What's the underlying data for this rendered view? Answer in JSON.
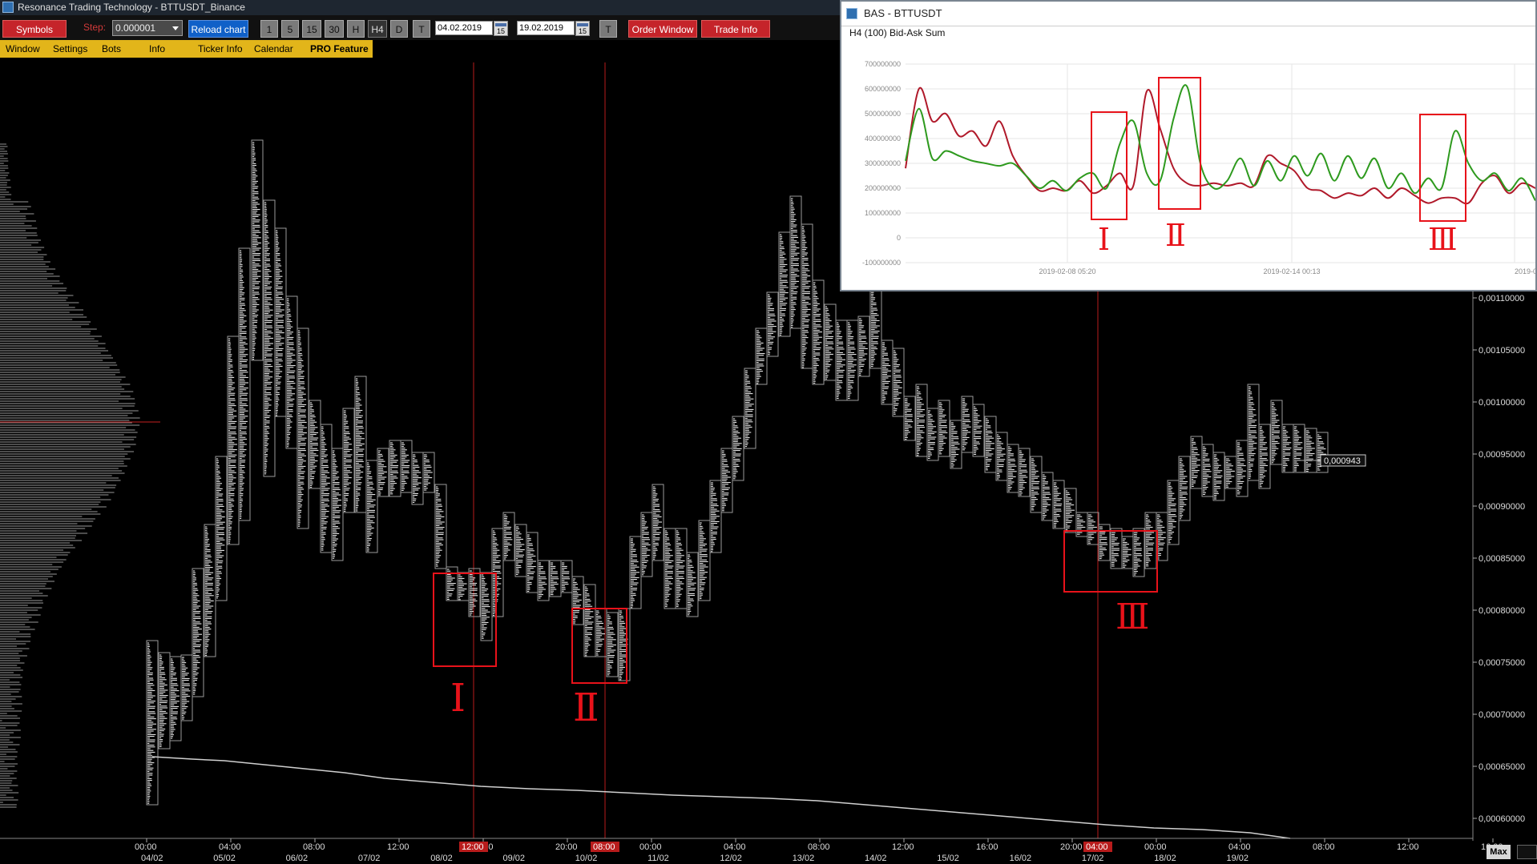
{
  "window": {
    "title": "Resonance Trading Technology - BTTUSDT_Binance"
  },
  "toolbar": {
    "symbols_label": "Symbols",
    "step_label": "Step:",
    "step_value": "0.000001",
    "reload_label": "Reload chart",
    "timeframes": [
      "1",
      "5",
      "15",
      "30",
      "H",
      "H4",
      "D"
    ],
    "t_label": "T",
    "date_from": "04.02.2019",
    "date_to": "19.02.2019",
    "calendar_day": "15",
    "order_window_label": "Order Window",
    "trade_info_label": "Trade Info"
  },
  "menu": {
    "items": [
      "Window",
      "Settings",
      "Bots",
      "Info",
      "Ticker Info",
      "Calendar",
      "PRO Feature"
    ]
  },
  "colors": {
    "accent_yellow": "#e2b51a",
    "button_red": "#c5242a",
    "button_blue": "#1060c8",
    "marker_red": "#e8121a",
    "series_red": "#b0192a",
    "series_green": "#2e9a1e"
  },
  "main_chart": {
    "price_ticks": [
      "0,00110000",
      "0,00105000",
      "0,00100000",
      "0,00095000",
      "0,00090000",
      "0,00085000",
      "0,00080000",
      "0,00075000",
      "0,00070000",
      "0,00065000",
      "0,00060000"
    ],
    "time_ticks": [
      "00:00",
      "04:00",
      "08:00",
      "12:00",
      "16:00",
      "20:00",
      "00:00",
      "04:00",
      "08:00",
      "12:00",
      "16:00",
      "20:00",
      "00:00",
      "04:00",
      "08:00",
      "12:00",
      "16:00",
      "20:00",
      "00:00",
      "04:00"
    ],
    "date_ticks": [
      "04/02",
      "05/02",
      "06/02",
      "07/02",
      "08/02",
      "09/02",
      "10/02",
      "11/02",
      "12/02",
      "13/02",
      "14/02",
      "15/02",
      "16/02",
      "17/02",
      "18/02",
      "19/02"
    ],
    "cursor_times": [
      "12:00",
      "08:00",
      "04:00"
    ],
    "current_price_label": "0,000943",
    "region_labels": [
      "Ⅰ",
      "Ⅱ",
      "Ⅲ"
    ]
  },
  "inset": {
    "window_title": "BAS - BTTUSDT",
    "subtitle": "H4 (100) Bid-Ask Sum",
    "y_ticks": [
      "700000000",
      "600000000",
      "500000000",
      "400000000",
      "300000000",
      "200000000",
      "100000000",
      "0",
      "-100000000"
    ],
    "x_ticks": [
      "2019-02-08 05:20",
      "2019-02-14 00:13",
      "2019-0"
    ],
    "region_labels": [
      "Ⅰ",
      "Ⅱ",
      "Ⅲ"
    ]
  },
  "chart_data": {
    "type": "line",
    "title": "H4 (100) Bid-Ask Sum",
    "ylim": [
      -100000000,
      700000000
    ],
    "x_ticks": [
      "2019-02-08 05:20",
      "2019-02-14 00:13",
      "2019-0"
    ],
    "series": [
      {
        "values": [
          280000000,
          600000000,
          470000000,
          500000000,
          410000000,
          430000000,
          370000000,
          470000000,
          330000000,
          250000000,
          190000000,
          200000000,
          190000000,
          230000000,
          180000000,
          210000000,
          260000000,
          210000000,
          590000000,
          440000000,
          280000000,
          220000000,
          210000000,
          220000000,
          210000000,
          220000000,
          210000000,
          330000000,
          300000000,
          270000000,
          200000000,
          190000000,
          160000000,
          180000000,
          170000000,
          200000000,
          160000000,
          200000000,
          170000000,
          140000000,
          160000000,
          160000000,
          140000000,
          220000000,
          250000000,
          180000000,
          220000000,
          200000000
        ]
      },
      {
        "values": [
          310000000,
          520000000,
          320000000,
          350000000,
          330000000,
          310000000,
          300000000,
          290000000,
          300000000,
          250000000,
          200000000,
          230000000,
          190000000,
          240000000,
          260000000,
          200000000,
          380000000,
          470000000,
          260000000,
          230000000,
          480000000,
          610000000,
          300000000,
          200000000,
          230000000,
          320000000,
          210000000,
          310000000,
          230000000,
          330000000,
          250000000,
          340000000,
          230000000,
          330000000,
          240000000,
          320000000,
          200000000,
          260000000,
          180000000,
          240000000,
          200000000,
          430000000,
          300000000,
          230000000,
          260000000,
          190000000,
          240000000,
          150000000
        ]
      }
    ]
  }
}
